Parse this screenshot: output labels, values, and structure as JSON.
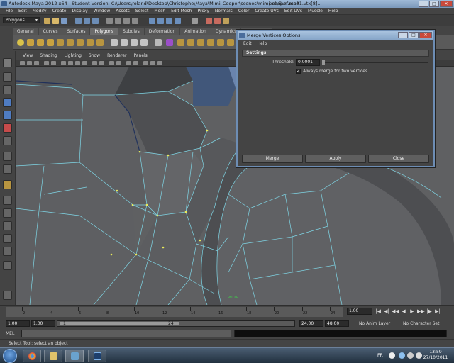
{
  "window": {
    "title": "Autodesk Maya 2012 x64 - Student Version: C:\\Users\\roland\\Desktop\\Christophe\\Maya\\Mimi_Cooper\\scenes\\mimi_cooper.mb*",
    "title_right": "---  polySurface21.vtx[8]...",
    "min": "–",
    "max": "□",
    "close": "✕"
  },
  "menubar": [
    "File",
    "Edit",
    "Modify",
    "Create",
    "Display",
    "Window",
    "Assets",
    "Select",
    "Mesh",
    "Edit Mesh",
    "Proxy",
    "Normals",
    "Color",
    "Create UVs",
    "Edit UVs",
    "Muscle",
    "Help"
  ],
  "statusline": {
    "mode": "Polygons"
  },
  "shelf": {
    "tabs": [
      "General",
      "Curves",
      "Surfaces",
      "Polygons",
      "Subdivs",
      "Deformation",
      "Animation",
      "Dynamics",
      "Rendering"
    ],
    "active": "Polygons"
  },
  "panel": {
    "menu": [
      "View",
      "Shading",
      "Lighting",
      "Show",
      "Renderer",
      "Panels"
    ],
    "camera_label": "persp"
  },
  "dialog": {
    "title": "Merge Vertices Options",
    "menu": [
      "Edit",
      "Help"
    ],
    "section": "Settings",
    "threshold_label": "Threshold:",
    "threshold_value": "0.0001",
    "checkbox_label": "Always merge for two vertices",
    "checkbox_mark": "✓",
    "buttons": {
      "merge": "Merge",
      "apply": "Apply",
      "close": "Close"
    },
    "min": "–",
    "max": "□",
    "close": "✕"
  },
  "timeslider": {
    "ticks": [
      "2",
      "4",
      "6",
      "8",
      "10",
      "12",
      "14",
      "16",
      "18",
      "20",
      "22",
      "24"
    ],
    "current": "1.00",
    "playback": [
      "|◀",
      "◀|",
      "◀◀",
      "◀",
      "▶",
      "▶▶",
      "|▶",
      "▶|"
    ]
  },
  "range": {
    "start": "1.00",
    "start_inner": "1.00",
    "start_mark": "1",
    "end_mark": "24",
    "end_inner": "24.00",
    "end": "48.00",
    "anim_layer": "No Anim Layer",
    "char_set": "No Character Set"
  },
  "cmdline": {
    "label": "MEL"
  },
  "helpline": {
    "text": "Select Tool: select an object"
  },
  "taskbar": {
    "language": "FR",
    "time": "13:59",
    "date": "27/10/2011"
  },
  "colors": {
    "viewport_bg": "#5f6062",
    "mesh_edge": "#7fd6e6",
    "vertex": "#e8ea5a",
    "dialog_border": "#6d8db4"
  }
}
